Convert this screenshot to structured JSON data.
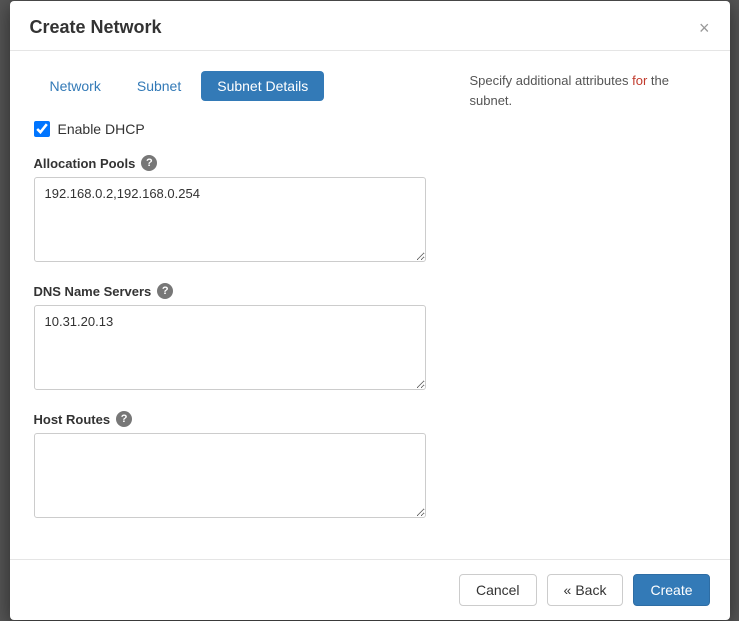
{
  "modal": {
    "title": "Create Network",
    "close_icon": "×"
  },
  "tabs": [
    {
      "id": "network",
      "label": "Network",
      "active": false
    },
    {
      "id": "subnet",
      "label": "Subnet",
      "active": false
    },
    {
      "id": "subnet-details",
      "label": "Subnet Details",
      "active": true
    }
  ],
  "form": {
    "enable_dhcp_label": "Enable DHCP",
    "enable_dhcp_checked": true,
    "allocation_pools": {
      "label": "Allocation Pools",
      "value": "192.168.0.2,192.168.0.254",
      "placeholder": ""
    },
    "dns_name_servers": {
      "label": "DNS Name Servers",
      "value": "10.31.20.13",
      "placeholder": ""
    },
    "host_routes": {
      "label": "Host Routes",
      "value": "",
      "placeholder": ""
    }
  },
  "hint": {
    "text_before": "Specify additional attributes ",
    "text_for": "for",
    "text_after": " the subnet."
  },
  "footer": {
    "cancel_label": "Cancel",
    "back_label": "Back",
    "back_arrow": "«",
    "create_label": "Create"
  }
}
